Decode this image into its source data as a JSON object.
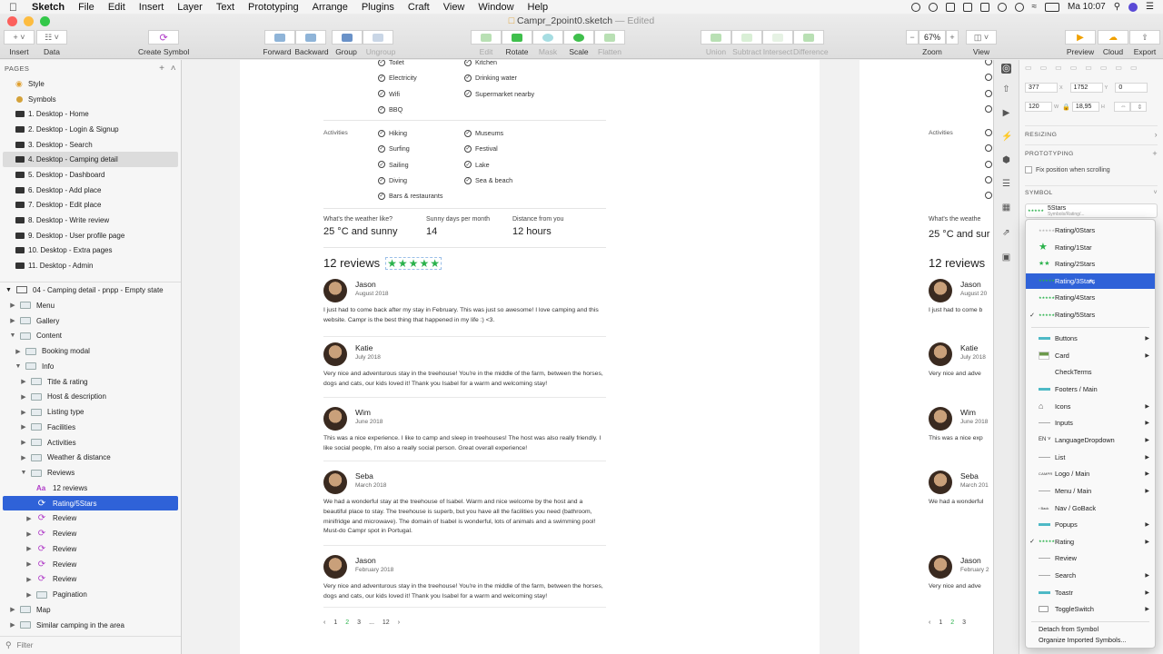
{
  "menubar": {
    "app": "Sketch",
    "items": [
      "File",
      "Edit",
      "Insert",
      "Layer",
      "Text",
      "Prototyping",
      "Arrange",
      "Plugins",
      "Craft",
      "View",
      "Window",
      "Help"
    ],
    "clock": "Ma 10:07"
  },
  "window": {
    "title": "Campr_2point0.sketch",
    "edited": "— Edited"
  },
  "toolbar": {
    "insert": "Insert",
    "data": "Data",
    "create_symbol": "Create Symbol",
    "forward": "Forward",
    "backward": "Backward",
    "group": "Group",
    "ungroup": "Ungroup",
    "edit": "Edit",
    "rotate": "Rotate",
    "mask": "Mask",
    "scale": "Scale",
    "flatten": "Flatten",
    "union": "Union",
    "subtract": "Subtract",
    "intersect": "Intersect",
    "difference": "Difference",
    "zoom_value": "67%",
    "zoom": "Zoom",
    "view": "View",
    "preview": "Preview",
    "cloud": "Cloud",
    "export": "Export"
  },
  "sidebar": {
    "pages_header": "PAGES",
    "pages": [
      {
        "label": "Style",
        "icon": "style-icon"
      },
      {
        "label": "Symbols",
        "icon": "symbols-icon"
      },
      {
        "label": "1. Desktop - Home",
        "icon": "desktop-icon"
      },
      {
        "label": "2. Desktop - Login & Signup",
        "icon": "desktop-icon"
      },
      {
        "label": "3. Desktop - Search",
        "icon": "desktop-icon"
      },
      {
        "label": "4. Desktop - Camping detail",
        "icon": "desktop-icon",
        "selected": true
      },
      {
        "label": "5. Desktop - Dashboard",
        "icon": "desktop-icon"
      },
      {
        "label": "6. Desktop - Add place",
        "icon": "desktop-icon"
      },
      {
        "label": "7. Desktop - Edit place",
        "icon": "desktop-icon"
      },
      {
        "label": "8. Desktop - Write review",
        "icon": "desktop-icon"
      },
      {
        "label": "9. Desktop - User profile page",
        "icon": "desktop-icon"
      },
      {
        "label": "10. Desktop - Extra pages",
        "icon": "desktop-icon"
      },
      {
        "label": "11. Desktop - Admin",
        "icon": "desktop-icon"
      }
    ],
    "artboard": "04 - Camping detail - pnpp - Empty state",
    "layers": [
      {
        "label": "Menu",
        "indent": 1,
        "type": "folder",
        "open": false
      },
      {
        "label": "Gallery",
        "indent": 1,
        "type": "folder",
        "open": false
      },
      {
        "label": "Content",
        "indent": 1,
        "type": "folder",
        "open": true
      },
      {
        "label": "Booking modal",
        "indent": 2,
        "type": "folder",
        "open": false
      },
      {
        "label": "Info",
        "indent": 2,
        "type": "folder",
        "open": true
      },
      {
        "label": "Title & rating",
        "indent": 3,
        "type": "folder",
        "open": false
      },
      {
        "label": "Host & description",
        "indent": 3,
        "type": "folder",
        "open": false
      },
      {
        "label": "Listing type",
        "indent": 3,
        "type": "folder",
        "open": false
      },
      {
        "label": "Facilities",
        "indent": 3,
        "type": "folder",
        "open": false
      },
      {
        "label": "Activities",
        "indent": 3,
        "type": "folder",
        "open": false
      },
      {
        "label": "Weather & distance",
        "indent": 3,
        "type": "folder",
        "open": false
      },
      {
        "label": "Reviews",
        "indent": 3,
        "type": "folder",
        "open": true
      },
      {
        "label": "12 reviews",
        "indent": 4,
        "type": "text"
      },
      {
        "label": "Rating/5Stars",
        "indent": 4,
        "type": "symbol",
        "selected": true
      },
      {
        "label": "Review",
        "indent": 4,
        "type": "symbol",
        "collapsible": true
      },
      {
        "label": "Review",
        "indent": 4,
        "type": "symbol",
        "collapsible": true
      },
      {
        "label": "Review",
        "indent": 4,
        "type": "symbol",
        "collapsible": true
      },
      {
        "label": "Review",
        "indent": 4,
        "type": "symbol",
        "collapsible": true
      },
      {
        "label": "Review",
        "indent": 4,
        "type": "symbol",
        "collapsible": true
      },
      {
        "label": "Pagination",
        "indent": 4,
        "type": "folder",
        "open": false
      },
      {
        "label": "Map",
        "indent": 1,
        "type": "folder",
        "open": false
      },
      {
        "label": "Similar camping in the area",
        "indent": 1,
        "type": "folder",
        "open": false
      }
    ],
    "filter": "Filter"
  },
  "canvas": {
    "facilities": {
      "col1": [
        "Toilet",
        "Electricity",
        "Wifi",
        "BBQ"
      ],
      "col2": [
        "Kitchen",
        "Drinking water",
        "Supermarket nearby"
      ]
    },
    "activities": {
      "label": "Activities",
      "col1": [
        "Hiking",
        "Surfing",
        "Sailing",
        "Diving",
        "Bars & restaurants"
      ],
      "col2": [
        "Museums",
        "Festival",
        "Lake",
        "Sea & beach"
      ]
    },
    "weather": [
      {
        "label": "What's the weather like?",
        "value": "25 °C and sunny"
      },
      {
        "label": "Sunny days per month",
        "value": "14"
      },
      {
        "label": "Distance from you",
        "value": "12 hours"
      }
    ],
    "reviews_title": "12 reviews",
    "rating": 5,
    "reviews": [
      {
        "name": "Jason",
        "date": "August 2018",
        "text": "I just had to come back after my stay in February. This was just so awesome! I love camping and this website. Campr is the best thing that happened in my life :) <3."
      },
      {
        "name": "Katie",
        "date": "July 2018",
        "text": "Very nice and adventurous stay in the treehouse! You're in the middle of the farm, between the horses, dogs and cats, our kids loved it! Thank you Isabel for a warm and welcoming stay!"
      },
      {
        "name": "Wim",
        "date": "June 2018",
        "text": "This was a nice experience. I like to camp and sleep in treehouses! The host was also really friendly. I like social people, I'm also a really social person. Great overall experience!"
      },
      {
        "name": "Seba",
        "date": "March 2018",
        "text": "We had a wonderful stay at the treehouse of Isabel. Warm and nice welcome by the host and a beautiful place to stay. The treehouse is superb, but you have all the facilities you need (bathroom, minifridge and microwave). The domain of Isabel is wonderful, lots of animals and a swimming pool! Must-do Campr spot in Portugal."
      },
      {
        "name": "Jason",
        "date": "February 2018",
        "text": "Very nice and adventurous stay in the treehouse! You're in the middle of the farm, between the horses, dogs and cats, our kids loved it! Thank you Isabel for a warm and welcoming stay!"
      }
    ],
    "pagination": [
      "‹",
      "1",
      "2",
      "3",
      "...",
      "12",
      "›"
    ],
    "pagination_current": "2",
    "second": {
      "activities_label": "Activities",
      "weather_label": "What's the weathe",
      "weather_value": "25 °C and sur",
      "reviews_title": "12 reviews",
      "reviews": [
        {
          "name": "Jason",
          "date": "August 20",
          "text": "I just had to come b"
        },
        {
          "name": "Katie",
          "date": "July 2018",
          "text": "Very nice and adve"
        },
        {
          "name": "Wim",
          "date": "June 2018",
          "text": "This was a nice exp"
        },
        {
          "name": "Seba",
          "date": "March 201",
          "text": "We had a wonderful"
        },
        {
          "name": "Jason",
          "date": "February 2",
          "text": "Very nice and adve"
        }
      ]
    }
  },
  "inspector": {
    "x": "377",
    "y": "1752",
    "rotation": "0",
    "width": "120",
    "height": "18,95",
    "x_lbl": "X",
    "y_lbl": "Y",
    "w_lbl": "W",
    "h_lbl": "H",
    "resizing": "RESIZING",
    "prototyping": "PROTOTYPING",
    "fix_position": "Fix position when scrolling",
    "symbol": "SYMBOL",
    "symbol_name": "5Stars",
    "symbol_path": "Symbols/Rating/..."
  },
  "dropdown": {
    "ratings": [
      {
        "label": "Rating/0Stars",
        "stars": 0
      },
      {
        "label": "Rating/1Star",
        "stars": 1
      },
      {
        "label": "Rating/2Stars",
        "stars": 2
      },
      {
        "label": "Rating/3Stars",
        "stars": 3,
        "highlighted": true
      },
      {
        "label": "Rating/4Stars",
        "stars": 4
      },
      {
        "label": "Rating/5Stars",
        "stars": 5,
        "checked": true
      }
    ],
    "groups": [
      {
        "label": "Buttons",
        "thumb": "teal-bar",
        "submenu": true
      },
      {
        "label": "Card",
        "thumb": "card-thumb",
        "submenu": true
      },
      {
        "label": "CheckTerms",
        "thumb": "none",
        "submenu": false
      },
      {
        "label": "Footers / Main",
        "thumb": "teal-bar",
        "submenu": false
      },
      {
        "label": "Icons",
        "thumb": "home-icon",
        "submenu": true
      },
      {
        "label": "Inputs",
        "thumb": "thin-line",
        "submenu": true
      },
      {
        "label": "LanguageDropdown",
        "thumb": "EN",
        "submenu": true
      },
      {
        "label": "List",
        "thumb": "thin-line",
        "submenu": true
      },
      {
        "label": "Logo / Main",
        "thumb": "CAMPR",
        "submenu": true
      },
      {
        "label": "Menu / Main",
        "thumb": "thin-line",
        "submenu": true
      },
      {
        "label": "Nav / GoBack",
        "thumb": "goback",
        "submenu": false
      },
      {
        "label": "Popups",
        "thumb": "teal-bar",
        "submenu": true
      },
      {
        "label": "Rating",
        "thumb": "mini-stars",
        "submenu": true,
        "checked": true
      },
      {
        "label": "Review",
        "thumb": "thin-line",
        "submenu": false
      },
      {
        "label": "Search",
        "thumb": "thin-line",
        "submenu": true
      },
      {
        "label": "Toastr",
        "thumb": "teal-bar",
        "submenu": true
      },
      {
        "label": "ToggleSwitch",
        "thumb": "toggle",
        "submenu": true
      }
    ],
    "detach": "Detach from Symbol",
    "organize": "Organize Imported Symbols..."
  },
  "colors": {
    "accent": "#2f62d8",
    "star_green": "#2bb24c",
    "teal": "#4eb9c6"
  }
}
